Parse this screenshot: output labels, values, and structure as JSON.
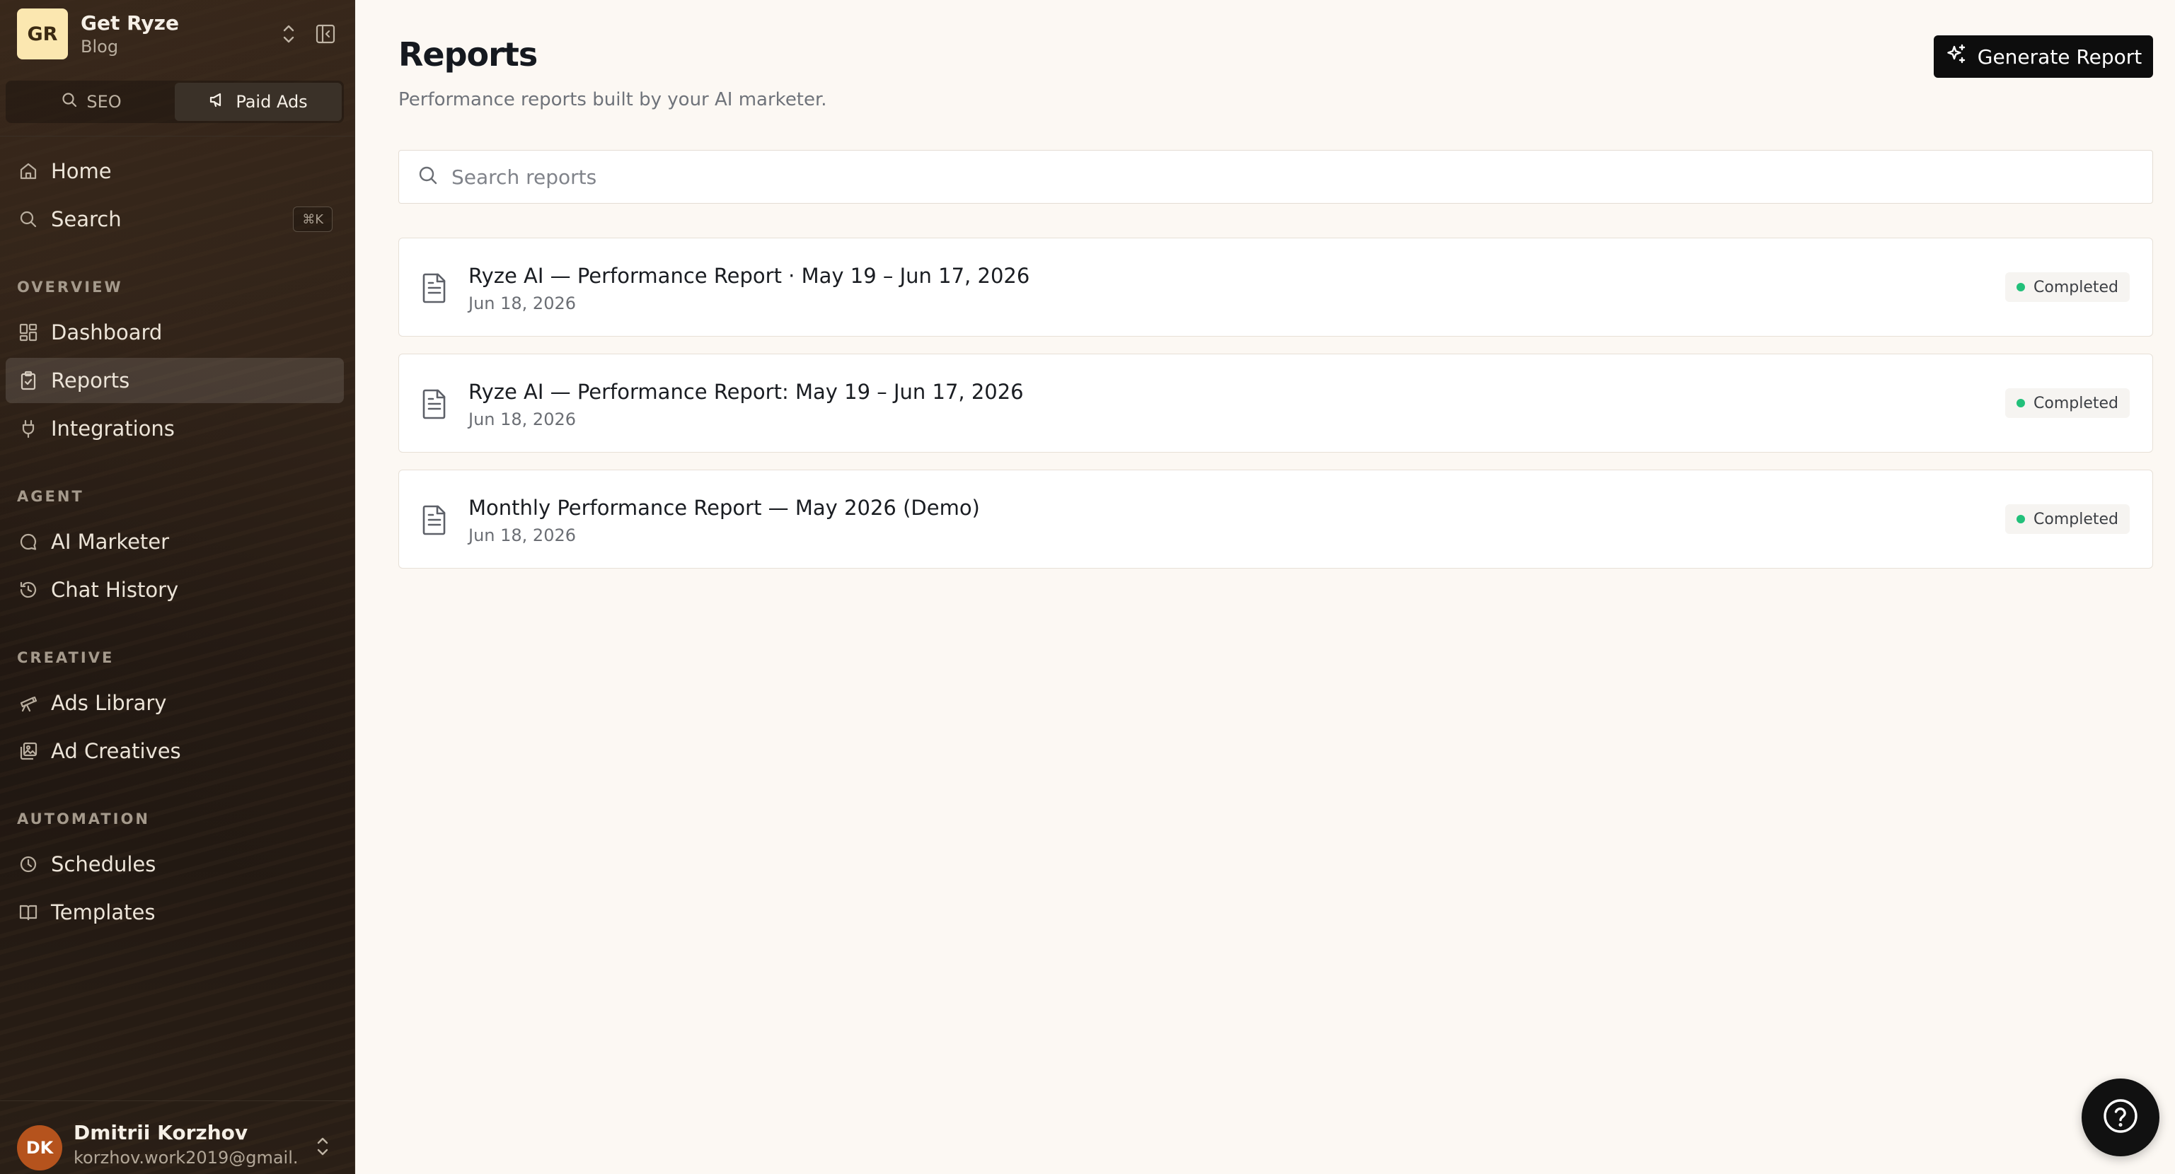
{
  "workspace": {
    "initials": "GR",
    "name": "Get Ryze",
    "subtitle": "Blog"
  },
  "mode_toggle": {
    "seo_label": "SEO",
    "paid_ads_label": "Paid Ads",
    "active": "Paid Ads"
  },
  "nav": {
    "home": "Home",
    "search": "Search",
    "search_shortcut": "⌘K",
    "overview_label": "OVERVIEW",
    "dashboard": "Dashboard",
    "reports": "Reports",
    "integrations": "Integrations",
    "agent_label": "AGENT",
    "ai_marketer": "AI Marketer",
    "chat_history": "Chat History",
    "creative_label": "CREATIVE",
    "ads_library": "Ads Library",
    "ad_creatives": "Ad Creatives",
    "automation_label": "AUTOMATION",
    "schedules": "Schedules",
    "templates": "Templates"
  },
  "user": {
    "initials": "DK",
    "name": "Dmitrii Korzhov",
    "email": "korzhov.work2019@gmail...."
  },
  "page": {
    "title": "Reports",
    "subtitle": "Performance reports built by your AI marketer.",
    "generate_label": "Generate Report",
    "search_placeholder": "Search reports"
  },
  "reports": [
    {
      "title": "Ryze AI — Performance Report · May 19 – Jun 17, 2026",
      "date": "Jun 18, 2026",
      "status": "Completed"
    },
    {
      "title": "Ryze AI — Performance Report: May 19 – Jun 17, 2026",
      "date": "Jun 18, 2026",
      "status": "Completed"
    },
    {
      "title": "Monthly Performance Report — May 2026 (Demo)",
      "date": "Jun 18, 2026",
      "status": "Completed"
    }
  ],
  "colors": {
    "accent": "#0d0d0d",
    "status_completed": "#22c07a",
    "background": "#fcf8f3",
    "sidebar": "#1d1510"
  }
}
